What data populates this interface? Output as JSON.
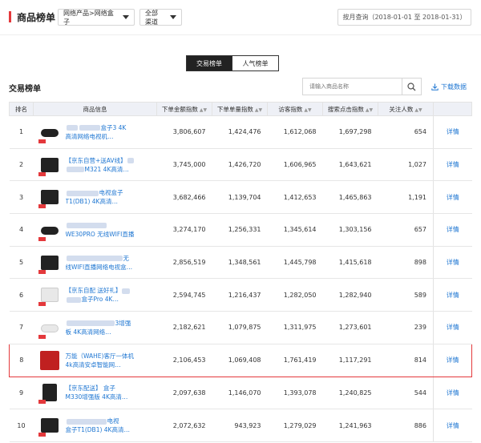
{
  "header": {
    "title": "商品榜单",
    "category": "网络产品>网络盒子",
    "channel": "全部渠道",
    "date_range": "按月查询（2018-01-01 至 2018-01-31）"
  },
  "tabs": [
    {
      "label": "交易榜单",
      "active": true
    },
    {
      "label": "人气榜单",
      "active": false
    }
  ],
  "section_title": "交易榜单",
  "search": {
    "placeholder": "请输入商品名称"
  },
  "download_label": "下载数据",
  "columns": [
    "排名",
    "商品信息",
    "下单金额指数",
    "下单单量指数",
    "访客指数",
    "搜索点击指数",
    "关注人数",
    ""
  ],
  "rows": [
    {
      "rank": "1",
      "line1": "盒子3 4K",
      "line2": "高清网络电视机…",
      "amount": "3,806,607",
      "orders": "1,424,476",
      "visitors": "1,612,068",
      "search": "1,697,298",
      "follows": "654",
      "detail": "详情"
    },
    {
      "rank": "2",
      "line1": "【京东自营+送AV线】",
      "line2": "M321 4K高清…",
      "amount": "3,745,000",
      "orders": "1,426,720",
      "visitors": "1,606,965",
      "search": "1,643,621",
      "follows": "1,027",
      "detail": "详情"
    },
    {
      "rank": "3",
      "line1": "电视盒子",
      "line2": "T1(DB1) 4K高清…",
      "amount": "3,682,466",
      "orders": "1,139,704",
      "visitors": "1,412,653",
      "search": "1,465,863",
      "follows": "1,191",
      "detail": "详情"
    },
    {
      "rank": "4",
      "line1": "",
      "line2": "WE30PRO 无线WIFI直播",
      "amount": "3,274,170",
      "orders": "1,256,331",
      "visitors": "1,345,614",
      "search": "1,303,156",
      "follows": "657",
      "detail": "详情"
    },
    {
      "rank": "5",
      "line1": "无",
      "line2": "线WIFI直播网络电视盒…",
      "amount": "2,856,519",
      "orders": "1,348,561",
      "visitors": "1,445,798",
      "search": "1,415,618",
      "follows": "898",
      "detail": "详情"
    },
    {
      "rank": "6",
      "line1": "【京东自配 送好礼】",
      "line2": "盒子Pro 4K…",
      "amount": "2,594,745",
      "orders": "1,216,437",
      "visitors": "1,282,050",
      "search": "1,282,940",
      "follows": "589",
      "detail": "详情"
    },
    {
      "rank": "7",
      "line1": "3增强",
      "line2": "板 4K高清网络…",
      "amount": "2,182,621",
      "orders": "1,079,875",
      "visitors": "1,311,975",
      "search": "1,273,601",
      "follows": "239",
      "detail": "详情"
    },
    {
      "rank": "8",
      "line1": "万能（WAHE)客厅一体机",
      "line2": "4k高清安卓智能网…",
      "amount": "2,106,453",
      "orders": "1,069,408",
      "visitors": "1,761,419",
      "search": "1,117,291",
      "follows": "814",
      "detail": "详情"
    },
    {
      "rank": "9",
      "line1": "【京东配送】 盒子",
      "line2": "M330增强版 4K高清…",
      "amount": "2,097,638",
      "orders": "1,146,070",
      "visitors": "1,393,078",
      "search": "1,240,825",
      "follows": "544",
      "detail": "详情"
    },
    {
      "rank": "10",
      "line1": "电视",
      "line2": "盒子T1(DB1) 4K高清…",
      "amount": "2,072,632",
      "orders": "943,923",
      "visitors": "1,279,029",
      "search": "1,241,963",
      "follows": "886",
      "detail": "详情"
    }
  ]
}
